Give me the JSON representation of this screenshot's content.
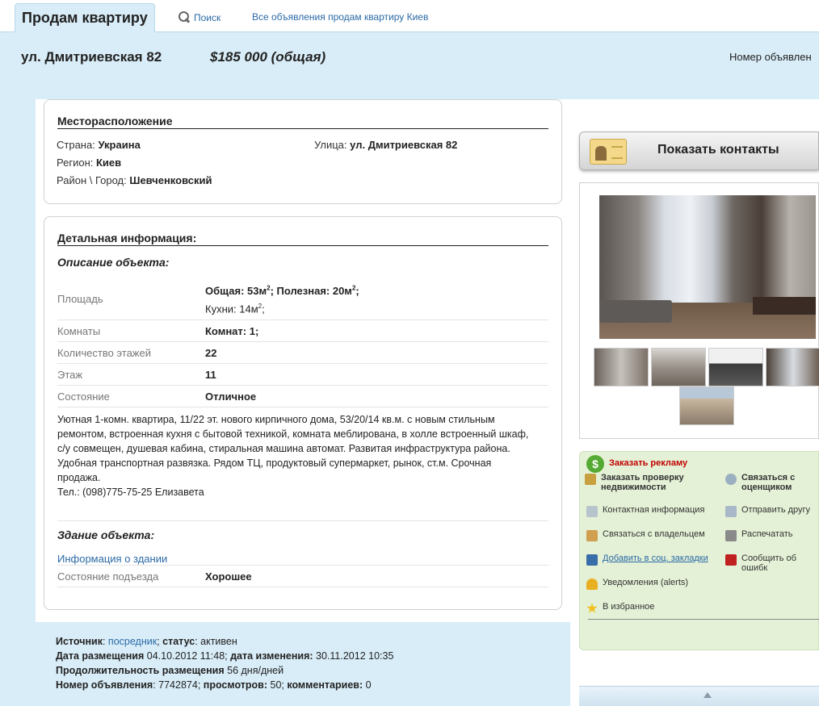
{
  "tabs": {
    "active": "Продам квартиру",
    "search": "Поиск",
    "all_ads": "Все объявления продам квартиру Киев"
  },
  "header": {
    "address": "ул. Дмитриевская 82",
    "price": "$185 000 (общая)",
    "ad_number_label": "Номер объявлен"
  },
  "location": {
    "title": "Месторасположение",
    "country_label": "Страна:",
    "country": "Украина",
    "street_label": "Улица:",
    "street": "ул. Дмитриевская 82",
    "region_label": "Регион:",
    "region": "Киев",
    "district_label": "Район \\ Город:",
    "district": "Шевченковский"
  },
  "details": {
    "title": "Детальная информация:",
    "object_title": "Описание объекта:",
    "area_label": "Площадь",
    "area_total_label": "Общая: 53м",
    "area_useful_label": "; Полезная: 20м",
    "area_tail": ";",
    "kitchen": "Кухни: 14м",
    "kitchen_tail": ";",
    "sup2": "2",
    "rooms_label": "Комнаты",
    "rooms": "Комнат: 1;",
    "floors_label": "Количество этажей",
    "floors": "22",
    "floor_label": "Этаж",
    "floor": "11",
    "condition_label": "Состояние",
    "condition": "Отличное",
    "description_lines": [
      "Уютная 1-комн. квартира, 11/22 эт. нового кирпичного дома, 53/20/14 кв.м. с новым стильным",
      "ремонтом, встроенная кухня с бытовой техникой, комната меблирована, в холле встроенный шкаф,",
      "с/у совмещен, душевая кабина, стиральная машина автомат. Развитая инфраструктура района.",
      "Удобная транспортная развязка. Рядом ТЦ, продуктовый супермаркет, рынок, ст.м. Срочная",
      "продажа.",
      "Тел.: (098)775-75-25 Елизавета"
    ],
    "building_title": "Здание объекта:",
    "building_info_link": "Информация о здании",
    "entrance_label": "Состояние подъезда",
    "entrance": "Хорошее"
  },
  "footer": {
    "source_label": "Источник",
    "source": "посредник",
    "status_label": "статус",
    "status": "активен",
    "posted_label": "Дата размещения",
    "posted": "04.10.2012 11:48",
    "changed_label": "дата изменения:",
    "changed": "30.11.2012 10:35",
    "duration_label": "Продолжительность размещения",
    "duration": "56 дня/дней",
    "adnum_label": "Номер объявления",
    "adnum": "7742874",
    "views_label": "просмотров:",
    "views": "50",
    "comments_label": "комментариев:",
    "comments": "0"
  },
  "sidebar": {
    "show_contacts": "Показать контакты",
    "order_ad": "Заказать рекламу",
    "order_check": "Заказать проверку недвижимости",
    "contact_appraiser": "Связаться с оценщиком",
    "contact_info": "Контактная информация",
    "send_friend": "Отправить другу",
    "contact_owner": "Связаться с владельцем",
    "print": "Распечатать",
    "add_social": "Добавить в соц. закладки",
    "report_error": "Сообщить об ошибк",
    "alerts": "Уведомления (alerts)",
    "favorites": "В избранное"
  },
  "colors": {
    "link": "#2b6aa6",
    "accent_bg": "#d9edf8",
    "actions_bg": "#e4f1d6",
    "order_ad": "#c00000"
  }
}
